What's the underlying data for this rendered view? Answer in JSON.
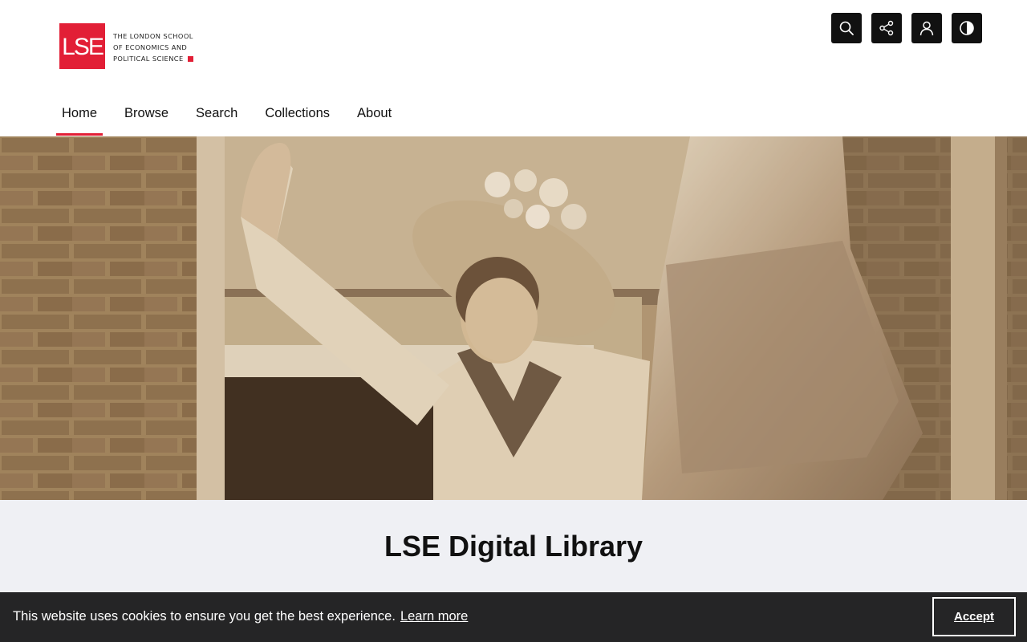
{
  "logo": {
    "mark": "LSE",
    "lines": [
      "The London School",
      "of Economics and",
      "Political Science"
    ],
    "brand_color": "#e21f36"
  },
  "tools": [
    {
      "name": "search-icon",
      "label": "Search"
    },
    {
      "name": "share-icon",
      "label": "Share"
    },
    {
      "name": "user-icon",
      "label": "Account"
    },
    {
      "name": "contrast-icon",
      "label": "Contrast"
    }
  ],
  "nav": {
    "items": [
      "Home",
      "Browse",
      "Search",
      "Collections",
      "About"
    ],
    "active": "Home"
  },
  "hero": {
    "image": "Sepia archival photograph of a woman in a flowered hat waving from a window beside a flag"
  },
  "page": {
    "title": "LSE Digital Library",
    "band_color": "#eff0f4"
  },
  "cookie": {
    "message": "This website uses cookies to ensure you get the best experience.",
    "link": "Learn more",
    "accept": "Accept"
  }
}
